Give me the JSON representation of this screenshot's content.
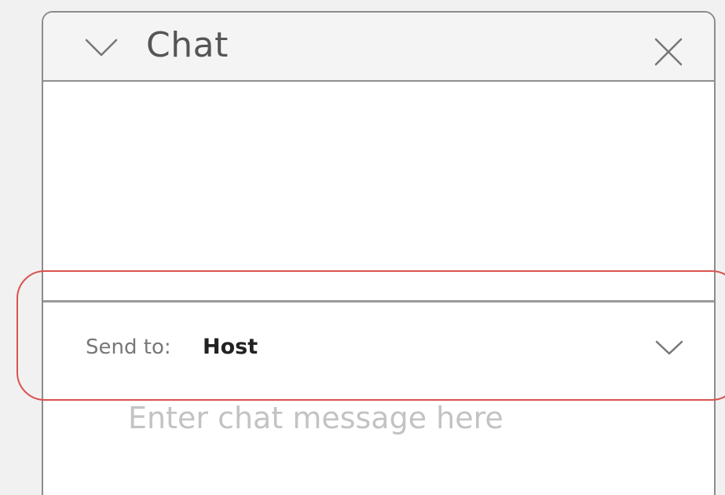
{
  "chat_panel": {
    "title": "Chat",
    "collapse_icon": "chevron-down-icon",
    "close_icon": "close-icon"
  },
  "send_to": {
    "label": "Send to:",
    "value": "Host",
    "dropdown_icon": "chevron-down-icon"
  },
  "message_input": {
    "value": "",
    "placeholder": "Enter chat message here"
  },
  "colors": {
    "highlight": "#d9534f",
    "panel_border": "#8c8c8c",
    "header_background": "#f4f4f4",
    "placeholder": "#c3c3c3"
  }
}
